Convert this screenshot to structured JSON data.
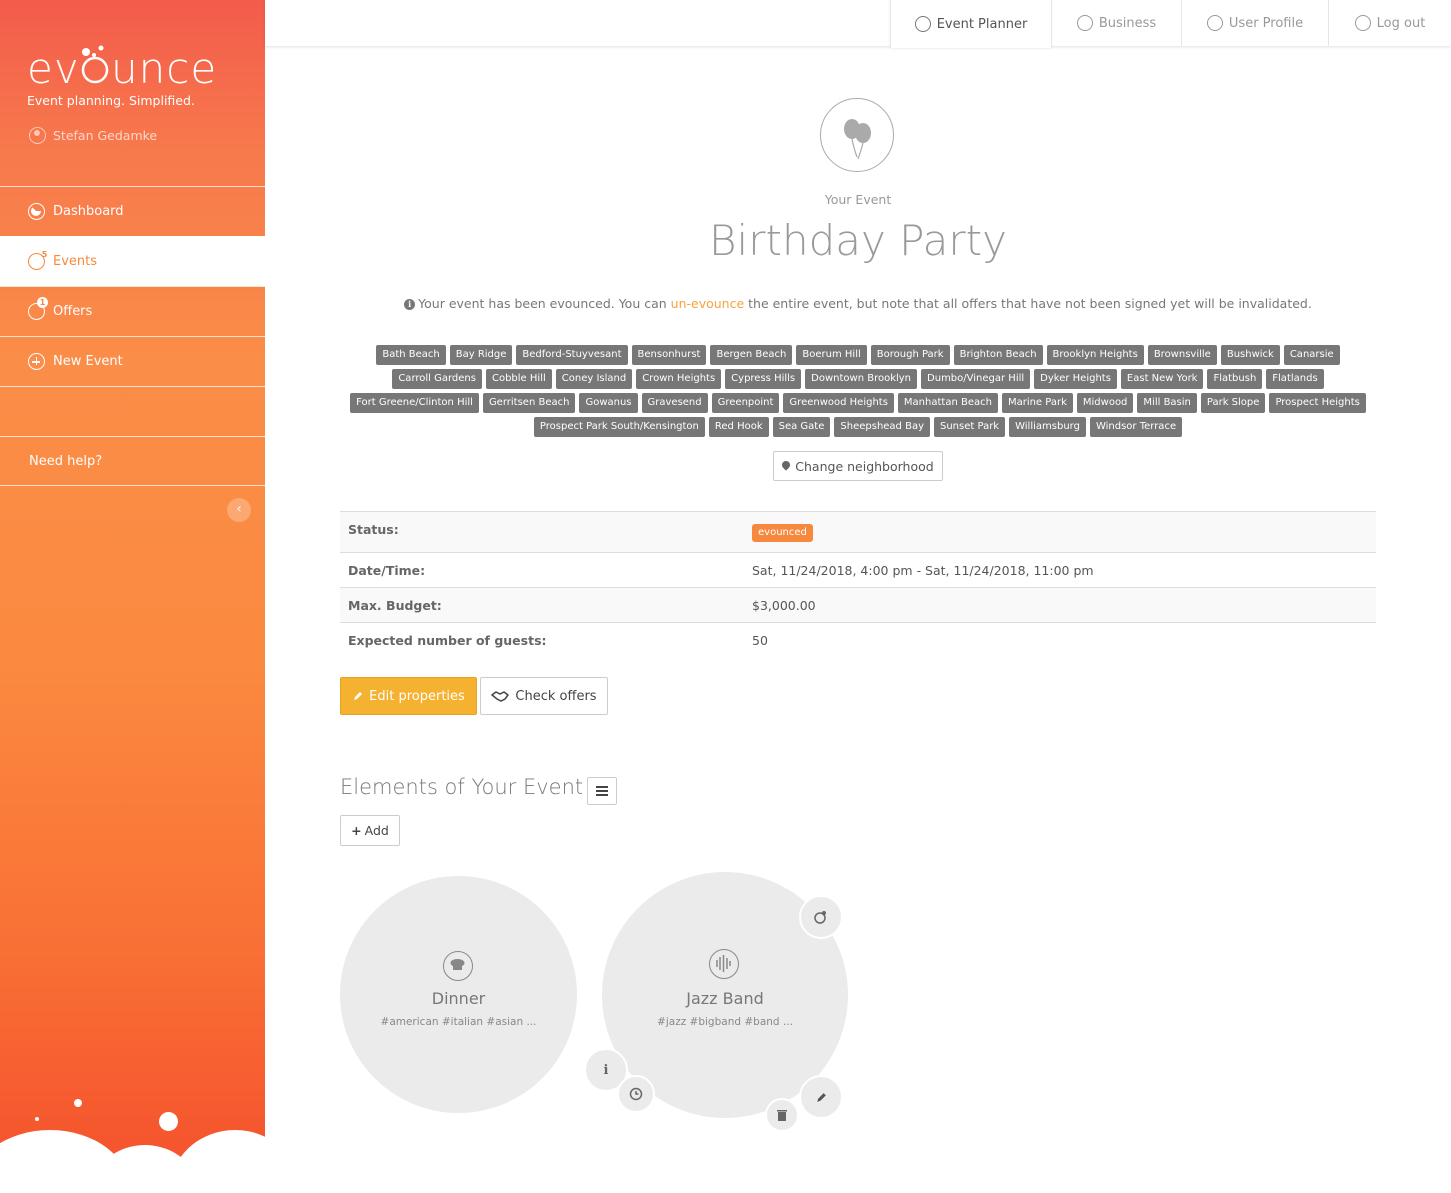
{
  "sidebar": {
    "logo_text": "evounce",
    "tagline": "Event planning. Simplified.",
    "user_name": "Stefan Gedamke",
    "nav": {
      "dashboard": "Dashboard",
      "events": "Events",
      "events_badge": "5",
      "offers": "Offers",
      "offers_badge": "1",
      "new_event": "New Event",
      "help": "Need help?"
    },
    "collapse_icon": "‹"
  },
  "topbar": {
    "tabs": {
      "planner": "Event Planner",
      "business": "Business",
      "profile": "User Profile",
      "logout": "Log out"
    }
  },
  "event": {
    "label": "Your Event",
    "title": "Birthday Party",
    "notice_pre": "Your event has been evounced. You can ",
    "notice_link": "un-evounce",
    "notice_post": " the entire event, but note that all offers that have not been signed yet will be invalidated.",
    "neighborhoods": [
      "Bath Beach",
      "Bay Ridge",
      "Bedford-Stuyvesant",
      "Bensonhurst",
      "Bergen Beach",
      "Boerum Hill",
      "Borough Park",
      "Brighton Beach",
      "Brooklyn Heights",
      "Brownsville",
      "Bushwick",
      "Canarsie",
      "Carroll Gardens",
      "Cobble Hill",
      "Coney Island",
      "Crown Heights",
      "Cypress Hills",
      "Downtown Brooklyn",
      "Dumbo/Vinegar Hill",
      "Dyker Heights",
      "East New York",
      "Flatbush",
      "Flatlands",
      "Fort Greene/Clinton Hill",
      "Gerritsen Beach",
      "Gowanus",
      "Gravesend",
      "Greenpoint",
      "Greenwood Heights",
      "Manhattan Beach",
      "Marine Park",
      "Midwood",
      "Mill Basin",
      "Park Slope",
      "Prospect Heights",
      "Prospect Park South/Kensington",
      "Red Hook",
      "Sea Gate",
      "Sheepshead Bay",
      "Sunset Park",
      "Williamsburg",
      "Windsor Terrace"
    ],
    "change_neighborhood": "Change neighborhood",
    "details": {
      "status_label": "Status:",
      "status_value": "evounced",
      "datetime_label": "Date/Time:",
      "datetime_value": "Sat, 11/24/2018, 4:00 pm - Sat, 11/24/2018, 11:00 pm",
      "budget_label": "Max. Budget:",
      "budget_value": "$3,000.00",
      "guests_label": "Expected number of guests:",
      "guests_value": "50"
    },
    "edit_button": "Edit properties",
    "check_button": "Check offers"
  },
  "elements": {
    "title": "Elements of Your Event",
    "add_button": "Add",
    "items": [
      {
        "name": "Dinner",
        "tags": "#american #italian #asian ..."
      },
      {
        "name": "Jazz Band",
        "tags": "#jazz #bigband #band ..."
      }
    ]
  },
  "colors": {
    "accent": "#f7893e",
    "edit_button": "#f5b130",
    "link": "#f7a23a"
  }
}
